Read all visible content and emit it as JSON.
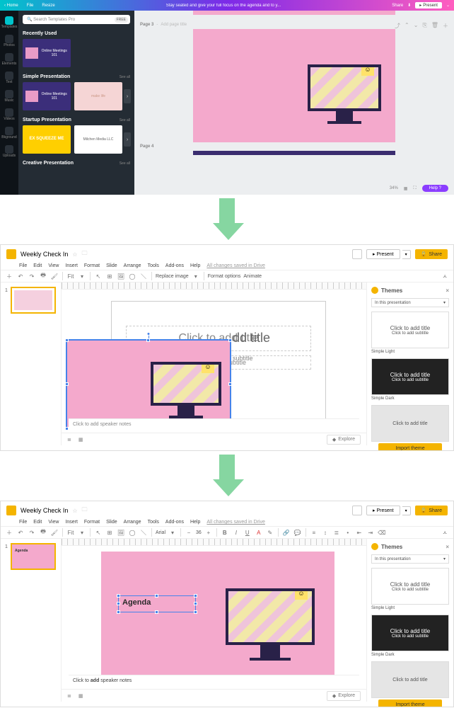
{
  "canva": {
    "top": {
      "home": "Home",
      "file": "File",
      "resize": "Resize",
      "title_hint": "Stay seated and give your full focus on the agenda and to y...",
      "share": "Share",
      "present": "Present"
    },
    "rail": [
      "Templates",
      "Photos",
      "Elements",
      "Text",
      "Music",
      "Videos",
      "Bkground",
      "Uploads"
    ],
    "search": {
      "placeholder": "Search Templates Pro",
      "badge": "FREE"
    },
    "sections": {
      "recent": {
        "title": "Recently Used",
        "thumb1": "Online Meetings 101"
      },
      "simple": {
        "title": "Simple Presentation",
        "seeall": "See all",
        "thumb1": "Online Meetings 101",
        "thumb2": "make life"
      },
      "startup": {
        "title": "Startup Presentation",
        "seeall": "See all",
        "thumb1": "EX SQUEEZE ME",
        "thumb2": "Milchen Media LLC"
      },
      "creative": {
        "title": "Creative Presentation",
        "seeall": "See all"
      }
    },
    "pages": {
      "p3": "Page 3",
      "p3_hint": "Add page title",
      "p4": "Page 4"
    },
    "footer": {
      "zoom": "34%",
      "help": "Help ?"
    },
    "sticky": "☺"
  },
  "gs": {
    "doc": "Weekly Check In",
    "menu": [
      "File",
      "Edit",
      "View",
      "Insert",
      "Format",
      "Slide",
      "Arrange",
      "Tools",
      "Add-ons",
      "Help"
    ],
    "saved": "All changes saved in Drive",
    "present": "Present",
    "share": "Share",
    "tools": {
      "zoom": "Fit",
      "font": "Arial",
      "size": "36",
      "replace": "Replace image",
      "format_opt": "Format options",
      "animate": "Animate"
    },
    "placeholders": {
      "title": "Click to add title",
      "subtitle": "Click to add subtitle",
      "title_partial": "dd title",
      "subtitle_partial": "subtitle"
    },
    "agenda": "Agenda",
    "notes": "Click to add speaker notes",
    "explore": "Explore",
    "themes": {
      "title": "Themes",
      "dropdown": "In this presentation",
      "light": "Simple Light",
      "dark": "Simple Dark",
      "card_title": "Click to add title",
      "card_sub": "Click to add subtitle",
      "import": "Import theme"
    }
  }
}
